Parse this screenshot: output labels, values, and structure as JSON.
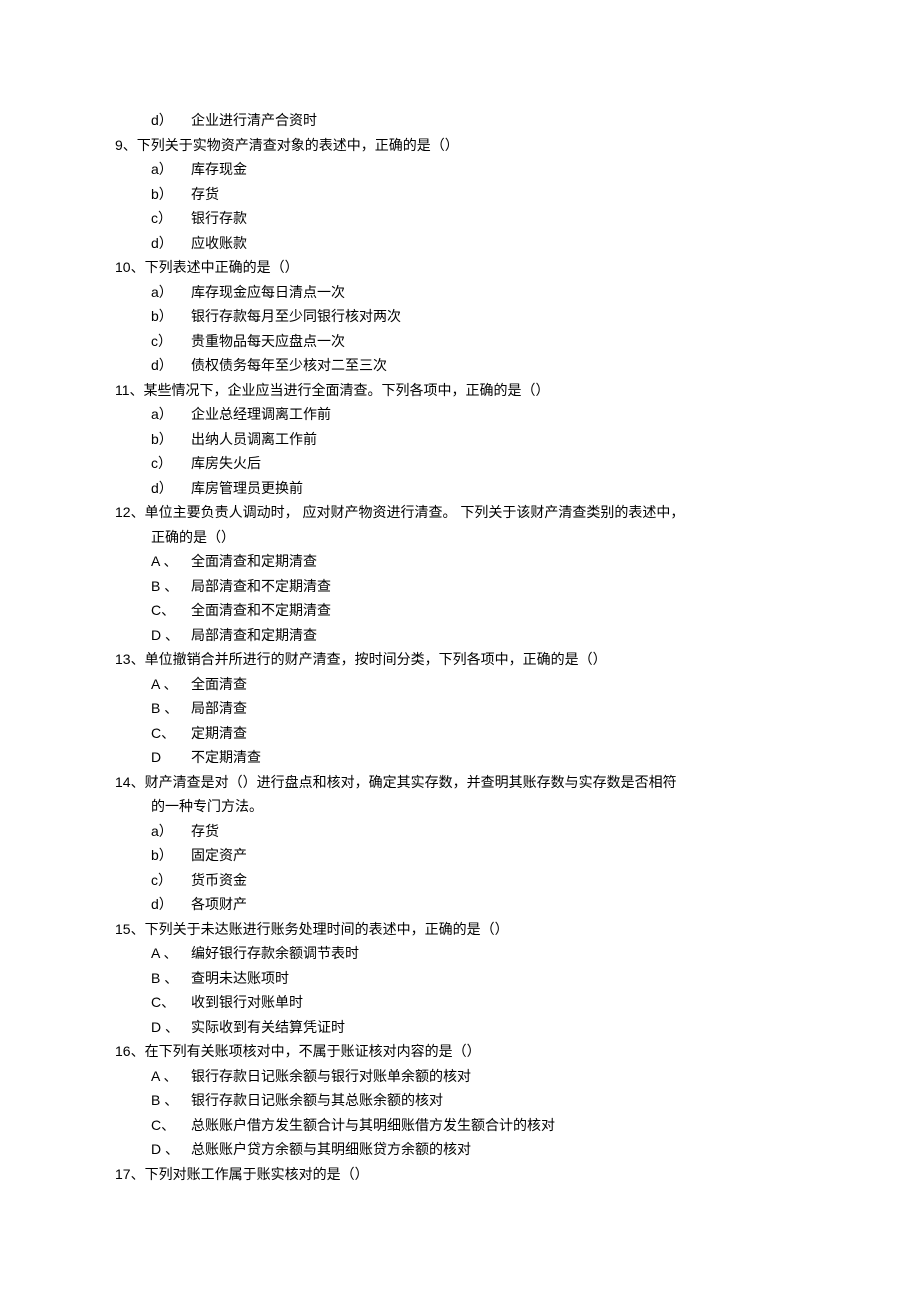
{
  "orphan_option": {
    "label": "d）",
    "text": "企业进行清产合资时"
  },
  "questions": [
    {
      "num": "9、",
      "stem": "下列关于实物资产清查对象的表述中，正确的是（）",
      "options": [
        {
          "label": "a）",
          "text": "库存现金"
        },
        {
          "label": "b）",
          "text": "存货"
        },
        {
          "label": "c）",
          "text": "银行存款"
        },
        {
          "label": "d）",
          "text": "应收账款"
        }
      ]
    },
    {
      "num": "10、",
      "stem": "下列表述中正确的是（）",
      "options": [
        {
          "label": "a）",
          "text": "库存现金应每日清点一次"
        },
        {
          "label": "b）",
          "text": "银行存款每月至少同银行核对两次"
        },
        {
          "label": "c）",
          "text": "贵重物品每天应盘点一次"
        },
        {
          "label": "d）",
          "text": "债权债务每年至少核对二至三次"
        }
      ]
    },
    {
      "num": "11、",
      "stem": "某些情况下，企业应当进行全面清查。下列各项中，正确的是（）",
      "options": [
        {
          "label": "a）",
          "text": "企业总经理调离工作前"
        },
        {
          "label": "b）",
          "text": "出纳人员调离工作前"
        },
        {
          "label": "c）",
          "text": "库房失火后"
        },
        {
          "label": "d）",
          "text": "库房管理员更换前"
        }
      ]
    },
    {
      "num": "12、",
      "stem": "单位主要负责人调动时， 应对财产物资进行清查。 下列关于该财产清查类别的表述中，",
      "stem_cont": "正确的是（）",
      "options": [
        {
          "label": "A 、",
          "text": "全面清查和定期清查"
        },
        {
          "label": "B 、",
          "text": "局部清查和不定期清查"
        },
        {
          "label": "C、",
          "text": "全面清查和不定期清查"
        },
        {
          "label": "D 、",
          "text": "局部清查和定期清查"
        }
      ]
    },
    {
      "num": "13、",
      "stem": "单位撤销合并所进行的财产清查，按时间分类，下列各项中，正确的是（）",
      "options": [
        {
          "label": "A 、",
          "text": "全面清查"
        },
        {
          "label": "B 、",
          "text": "局部清查"
        },
        {
          "label": "C、",
          "text": "定期清查"
        },
        {
          "label": "D ",
          "text": "不定期清查"
        }
      ]
    },
    {
      "num": "14、",
      "stem": "财产清查是对（）进行盘点和核对，确定其实存数，并查明其账存数与实存数是否相符",
      "stem_cont": "的一种专门方法。",
      "options": [
        {
          "label": "a）",
          "text": "存货"
        },
        {
          "label": "b）",
          "text": "固定资产"
        },
        {
          "label": "c）",
          "text": "货币资金"
        },
        {
          "label": "d）",
          "text": "各项财产"
        }
      ]
    },
    {
      "num": "15、",
      "stem": "下列关于未达账进行账务处理时间的表述中，正确的是（）",
      "options": [
        {
          "label": "A 、",
          "text": "编好银行存款余额调节表时"
        },
        {
          "label": "B 、",
          "text": "查明未达账项时"
        },
        {
          "label": "C、",
          "text": "收到银行对账单时"
        },
        {
          "label": "D 、",
          "text": "实际收到有关结算凭证时"
        }
      ]
    },
    {
      "num": "16、",
      "stem": "在下列有关账项核对中，不属于账证核对内容的是（）",
      "options": [
        {
          "label": "A 、",
          "text": "银行存款日记账余额与银行对账单余额的核对"
        },
        {
          "label": "B 、",
          "text": "银行存款日记账余额与其总账余额的核对"
        },
        {
          "label": "C、",
          "text": "总账账户借方发生额合计与其明细账借方发生额合计的核对"
        },
        {
          "label": "D 、",
          "text": "总账账户贷方余额与其明细账贷方余额的核对"
        }
      ]
    },
    {
      "num": "17、",
      "stem": "下列对账工作属于账实核对的是（）",
      "options": []
    }
  ]
}
